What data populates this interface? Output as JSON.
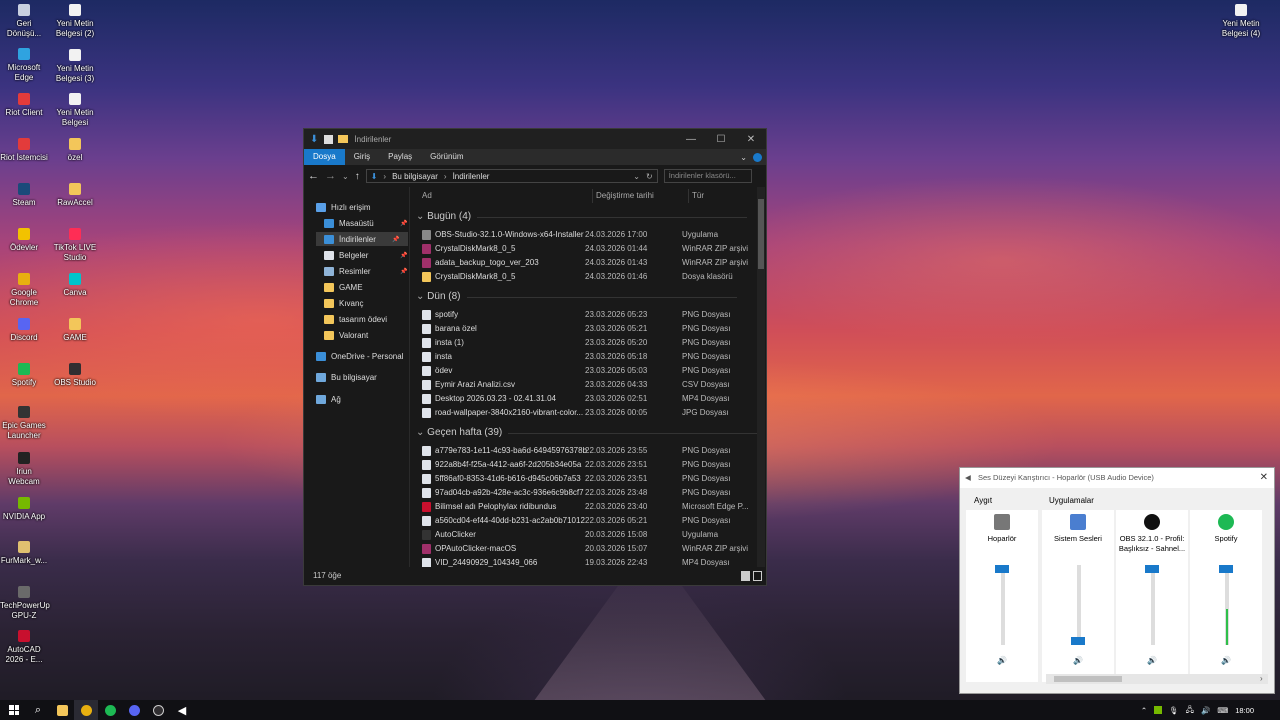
{
  "desktop": {
    "icons": [
      {
        "label": "Geri Dönüşü...",
        "icon": "recycle-bin-icon",
        "color": "#c8d0e0"
      },
      {
        "label": "Microsoft Edge",
        "icon": "edge-icon",
        "color": "#2fa3e0"
      },
      {
        "label": "Riot Client",
        "icon": "riot-icon",
        "color": "#e33b3b"
      },
      {
        "label": "Riot İstemcisi",
        "icon": "riot-icon",
        "color": "#e33b3b"
      },
      {
        "label": "Steam",
        "icon": "steam-icon",
        "color": "#1b4a7a"
      },
      {
        "label": "Ödevler",
        "icon": "warning-icon",
        "color": "#f2c200"
      },
      {
        "label": "Google Chrome",
        "icon": "chrome-icon",
        "color": "#e8b010"
      },
      {
        "label": "Discord",
        "icon": "discord-icon",
        "color": "#5865f2"
      },
      {
        "label": "Spotify",
        "icon": "spotify-icon",
        "color": "#1db954"
      },
      {
        "label": "Epic Games Launcher",
        "icon": "epic-icon",
        "color": "#333333"
      },
      {
        "label": "Iriun Webcam",
        "icon": "webcam-icon",
        "color": "#222222"
      },
      {
        "label": "NVIDIA App",
        "icon": "nvidia-icon",
        "color": "#76b900"
      },
      {
        "label": "FurMark_w...",
        "icon": "furmark-icon",
        "color": "#e0c070"
      },
      {
        "label": "TechPowerUp GPU-Z",
        "icon": "gpuz-icon",
        "color": "#6a6a6a"
      },
      {
        "label": "AutoCAD 2026 - E...",
        "icon": "autocad-icon",
        "color": "#c8102e"
      },
      {
        "label": "Yeni Metin Belgesi (2)",
        "icon": "text-file-icon",
        "color": "#f2f2f2"
      },
      {
        "label": "Yeni Metin Belgesi (3)",
        "icon": "text-file-icon",
        "color": "#f2f2f2"
      },
      {
        "label": "Yeni Metin Belgesi",
        "icon": "text-file-icon",
        "color": "#f2f2f2"
      },
      {
        "label": "özel",
        "icon": "folder-icon",
        "color": "#f3c65a"
      },
      {
        "label": "RawAccel",
        "icon": "folder-icon",
        "color": "#f3c65a"
      },
      {
        "label": "TikTok LIVE Studio",
        "icon": "tiktok-icon",
        "color": "#ff2d55"
      },
      {
        "label": "Canva",
        "icon": "canva-icon",
        "color": "#00c4cc"
      },
      {
        "label": "GAME",
        "icon": "folder-icon",
        "color": "#f3c65a"
      },
      {
        "label": "OBS Studio",
        "icon": "obs-icon",
        "color": "#302e31"
      },
      {
        "label": "Yeni Metin Belgesi (4)",
        "icon": "text-file-icon",
        "color": "#f2f2f2"
      }
    ]
  },
  "explorer": {
    "title": "İndirilenler",
    "ribbon_tabs": [
      "Dosya",
      "Giriş",
      "Paylaş",
      "Görünüm"
    ],
    "breadcrumb": [
      "Bu bilgisayar",
      "İndirilenler"
    ],
    "search_placeholder": "İndirilenler klasörü...",
    "nav": [
      {
        "label": "Hızlı erişim",
        "color": "#5aa0e8"
      },
      {
        "label": "Masaüstü",
        "color": "#3b8fd8"
      },
      {
        "label": "İndirilenler",
        "color": "#3b8fd8"
      },
      {
        "label": "Belgeler",
        "color": "#dfe3ea"
      },
      {
        "label": "Resimler",
        "color": "#8fb4d8"
      },
      {
        "label": "GAME",
        "color": "#f3c65a"
      },
      {
        "label": "Kıvanç",
        "color": "#f3c65a"
      },
      {
        "label": "tasarım ödevi",
        "color": "#f3c65a"
      },
      {
        "label": "Valorant",
        "color": "#f3c65a"
      },
      {
        "label": "OneDrive - Personal",
        "color": "#3b8fd8"
      },
      {
        "label": "Bu bilgisayar",
        "color": "#6fa8dc"
      },
      {
        "label": "Ağ",
        "color": "#6fa8dc"
      }
    ],
    "columns": [
      "Ad",
      "Değiştirme tarihi",
      "Tür"
    ],
    "groups": [
      {
        "label": "Bugün (4)",
        "rows": [
          {
            "name": "OBS-Studio-32.1.0-Windows-x64-Installer",
            "date": "24.03.2026 17:00",
            "type": "Uygulama",
            "color": "#888888"
          },
          {
            "name": "CrystalDiskMark8_0_5",
            "date": "24.03.2026 01:44",
            "type": "WinRAR ZIP arşivi",
            "color": "#a0306a"
          },
          {
            "name": "adata_backup_togo_ver_203",
            "date": "24.03.2026 01:43",
            "type": "WinRAR ZIP arşivi",
            "color": "#a0306a"
          },
          {
            "name": "CrystalDiskMark8_0_5",
            "date": "24.03.2026 01:46",
            "type": "Dosya klasörü",
            "color": "#f3c65a"
          }
        ]
      },
      {
        "label": "Dün (8)",
        "rows": [
          {
            "name": "spotify",
            "date": "23.03.2026 05:23",
            "type": "PNG Dosyası",
            "color": "#dfe3ea"
          },
          {
            "name": "barana özel",
            "date": "23.03.2026 05:21",
            "type": "PNG Dosyası",
            "color": "#dfe3ea"
          },
          {
            "name": "insta (1)",
            "date": "23.03.2026 05:20",
            "type": "PNG Dosyası",
            "color": "#dfe3ea"
          },
          {
            "name": "insta",
            "date": "23.03.2026 05:18",
            "type": "PNG Dosyası",
            "color": "#dfe3ea"
          },
          {
            "name": "ödev",
            "date": "23.03.2026 05:03",
            "type": "PNG Dosyası",
            "color": "#dfe3ea"
          },
          {
            "name": "Eymir Arazi Analizi.csv",
            "date": "23.03.2026 04:33",
            "type": "CSV Dosyası",
            "color": "#dfe3ea"
          },
          {
            "name": "Desktop 2026.03.23 - 02.41.31.04",
            "date": "23.03.2026 02:51",
            "type": "MP4 Dosyası",
            "color": "#dfe3ea"
          },
          {
            "name": "road-wallpaper-3840x2160-vibrant-color...",
            "date": "23.03.2026 00:05",
            "type": "JPG Dosyası",
            "color": "#dfe3ea"
          }
        ]
      },
      {
        "label": "Geçen hafta (39)",
        "rows": [
          {
            "name": "a779e783-1e11-4c93-ba6d-64945976378b",
            "date": "22.03.2026 23:55",
            "type": "PNG Dosyası",
            "color": "#dfe3ea"
          },
          {
            "name": "922a8b4f-f25a-4412-aa6f-2d205b34e05a",
            "date": "22.03.2026 23:51",
            "type": "PNG Dosyası",
            "color": "#dfe3ea"
          },
          {
            "name": "5ff86af0-8353-41d6-b616-d945c06b7a53",
            "date": "22.03.2026 23:51",
            "type": "PNG Dosyası",
            "color": "#dfe3ea"
          },
          {
            "name": "97ad04cb-a92b-428e-ac3c-936e6c9b8cf7",
            "date": "22.03.2026 23:48",
            "type": "PNG Dosyası",
            "color": "#dfe3ea"
          },
          {
            "name": "Bilimsel adı Pelophylax ridibundus",
            "date": "22.03.2026 23:40",
            "type": "Microsoft Edge P...",
            "color": "#c8102e"
          },
          {
            "name": "a560cd04-ef44-40dd-b231-ac2ab0b71012",
            "date": "22.03.2026 05:21",
            "type": "PNG Dosyası",
            "color": "#dfe3ea"
          },
          {
            "name": "AutoClicker",
            "date": "20.03.2026 15:08",
            "type": "Uygulama",
            "color": "#333333"
          },
          {
            "name": "OPAutoClicker-macOS",
            "date": "20.03.2026 15:07",
            "type": "WinRAR ZIP arşivi",
            "color": "#a0306a"
          },
          {
            "name": "VID_24490929_104349_066",
            "date": "19.03.2026 22:43",
            "type": "MP4 Dosyası",
            "color": "#dfe3ea"
          }
        ]
      }
    ],
    "status": "117 öğe"
  },
  "mixer": {
    "title": "Ses Düzeyi Karıştırıcı - Hoparlör (USB Audio Device)",
    "device_header": "Aygıt",
    "apps_header": "Uygulamalar",
    "channels": [
      {
        "label": "Hoparlör",
        "icon": "speaker-device-icon",
        "level": 1.0,
        "meter": 0
      },
      {
        "label": "Sistem Sesleri",
        "icon": "system-sounds-icon",
        "level": 0.0,
        "meter": 0
      },
      {
        "label": "OBS 32.1.0 - Profil: Başlıksız - Sahnel...",
        "icon": "obs-icon",
        "level": 1.0,
        "meter": 0
      },
      {
        "label": "Spotify",
        "icon": "spotify-icon",
        "level": 1.0,
        "meter": 0.45
      }
    ]
  },
  "taskbar": {
    "time": "18:00"
  }
}
